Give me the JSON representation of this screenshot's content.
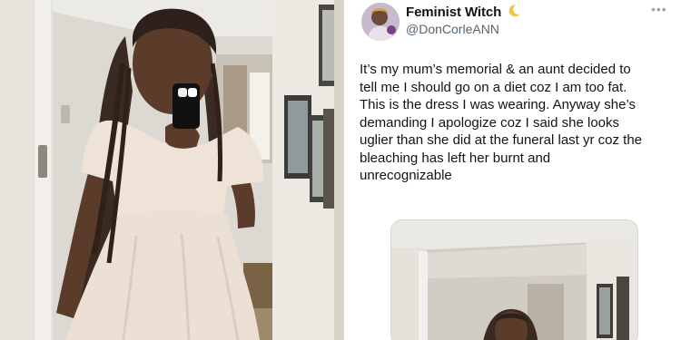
{
  "tweet": {
    "author": {
      "display_name": "Feminist Witch",
      "name_emoji_icon": "crescent-moon-icon",
      "handle": "@DonCorleANN"
    },
    "more_menu_icon": "more-horizontal-icon",
    "text_lines": [
      "It’s my mum’s memorial & an aunt  decided to",
      "tell me I should go on a diet coz I am too fat.",
      "This is the dress I was wearing. Anyway she’s",
      "demanding I apologize coz I said she looks",
      "uglier than she did at the funeral last yr coz the",
      "bleaching has left her burnt and",
      "unrecognizable"
    ]
  },
  "colors": {
    "text_primary": "#0f1419",
    "text_secondary": "#536471",
    "moon": "#f4c542",
    "dress": "#ecdfd3"
  }
}
